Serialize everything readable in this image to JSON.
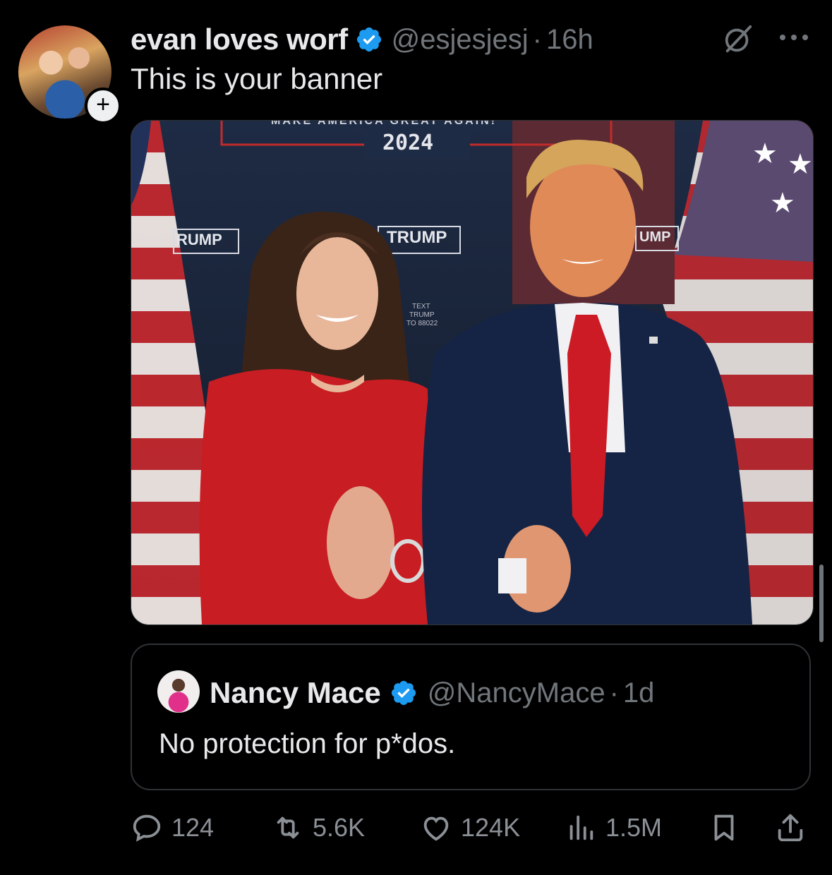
{
  "tweet": {
    "author": {
      "display_name": "evan loves worf",
      "handle": "@esjesjesj",
      "time": "16h",
      "separator": "·"
    },
    "text": "This is your banner",
    "follow_symbol": "+",
    "media": {
      "banner_label": "MAKE AMERICA GREAT AGAIN!",
      "banner_year": "2024",
      "sign_labels": [
        "RUMP",
        "TRUMP",
        "UMP"
      ],
      "sign_small": "MAKE AMERICA GREAT AGAIN",
      "sign_year": "2024",
      "text_sign": [
        "TEXT",
        "TRUMP",
        "TO 88022"
      ]
    },
    "quote": {
      "display_name": "Nancy Mace",
      "handle": "@NancyMace",
      "time": "1d",
      "separator": "·",
      "text": "No protection for p*dos."
    },
    "actions": {
      "replies": "124",
      "reposts": "5.6K",
      "likes": "124K",
      "views": "1.5M"
    }
  },
  "colors": {
    "background": "#000000",
    "text": "#e7e9ea",
    "secondary": "#71767b",
    "verified": "#1d9bf0",
    "border": "#2f3336"
  },
  "icons": [
    "grok-icon",
    "more-icon",
    "verified-icon",
    "reply-icon",
    "repost-icon",
    "like-icon",
    "views-icon",
    "bookmark-icon",
    "share-icon"
  ]
}
